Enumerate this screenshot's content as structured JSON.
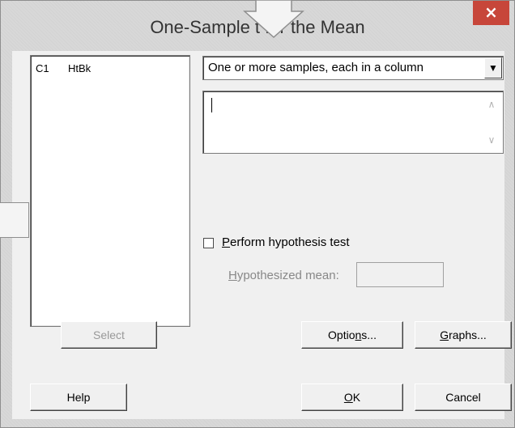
{
  "window": {
    "title": "One-Sample t for the Mean",
    "close_label": "×"
  },
  "variables": {
    "items": [
      {
        "column": "C1",
        "name": "HtBk"
      }
    ],
    "select_label": "Select"
  },
  "data_input": {
    "mode_selected": "One or more samples, each in a column",
    "dropdown_arrow": "▼",
    "text_value": "",
    "scroll_up": "∧",
    "scroll_down": "∨"
  },
  "hypothesis": {
    "checkbox_label": "Perform hypothesis test",
    "checkbox_checked": false,
    "mean_label": "Hypothesized mean:",
    "mean_value": ""
  },
  "buttons": {
    "options": "Options...",
    "graphs": "Graphs...",
    "help": "Help",
    "ok": "OK",
    "cancel": "Cancel"
  }
}
